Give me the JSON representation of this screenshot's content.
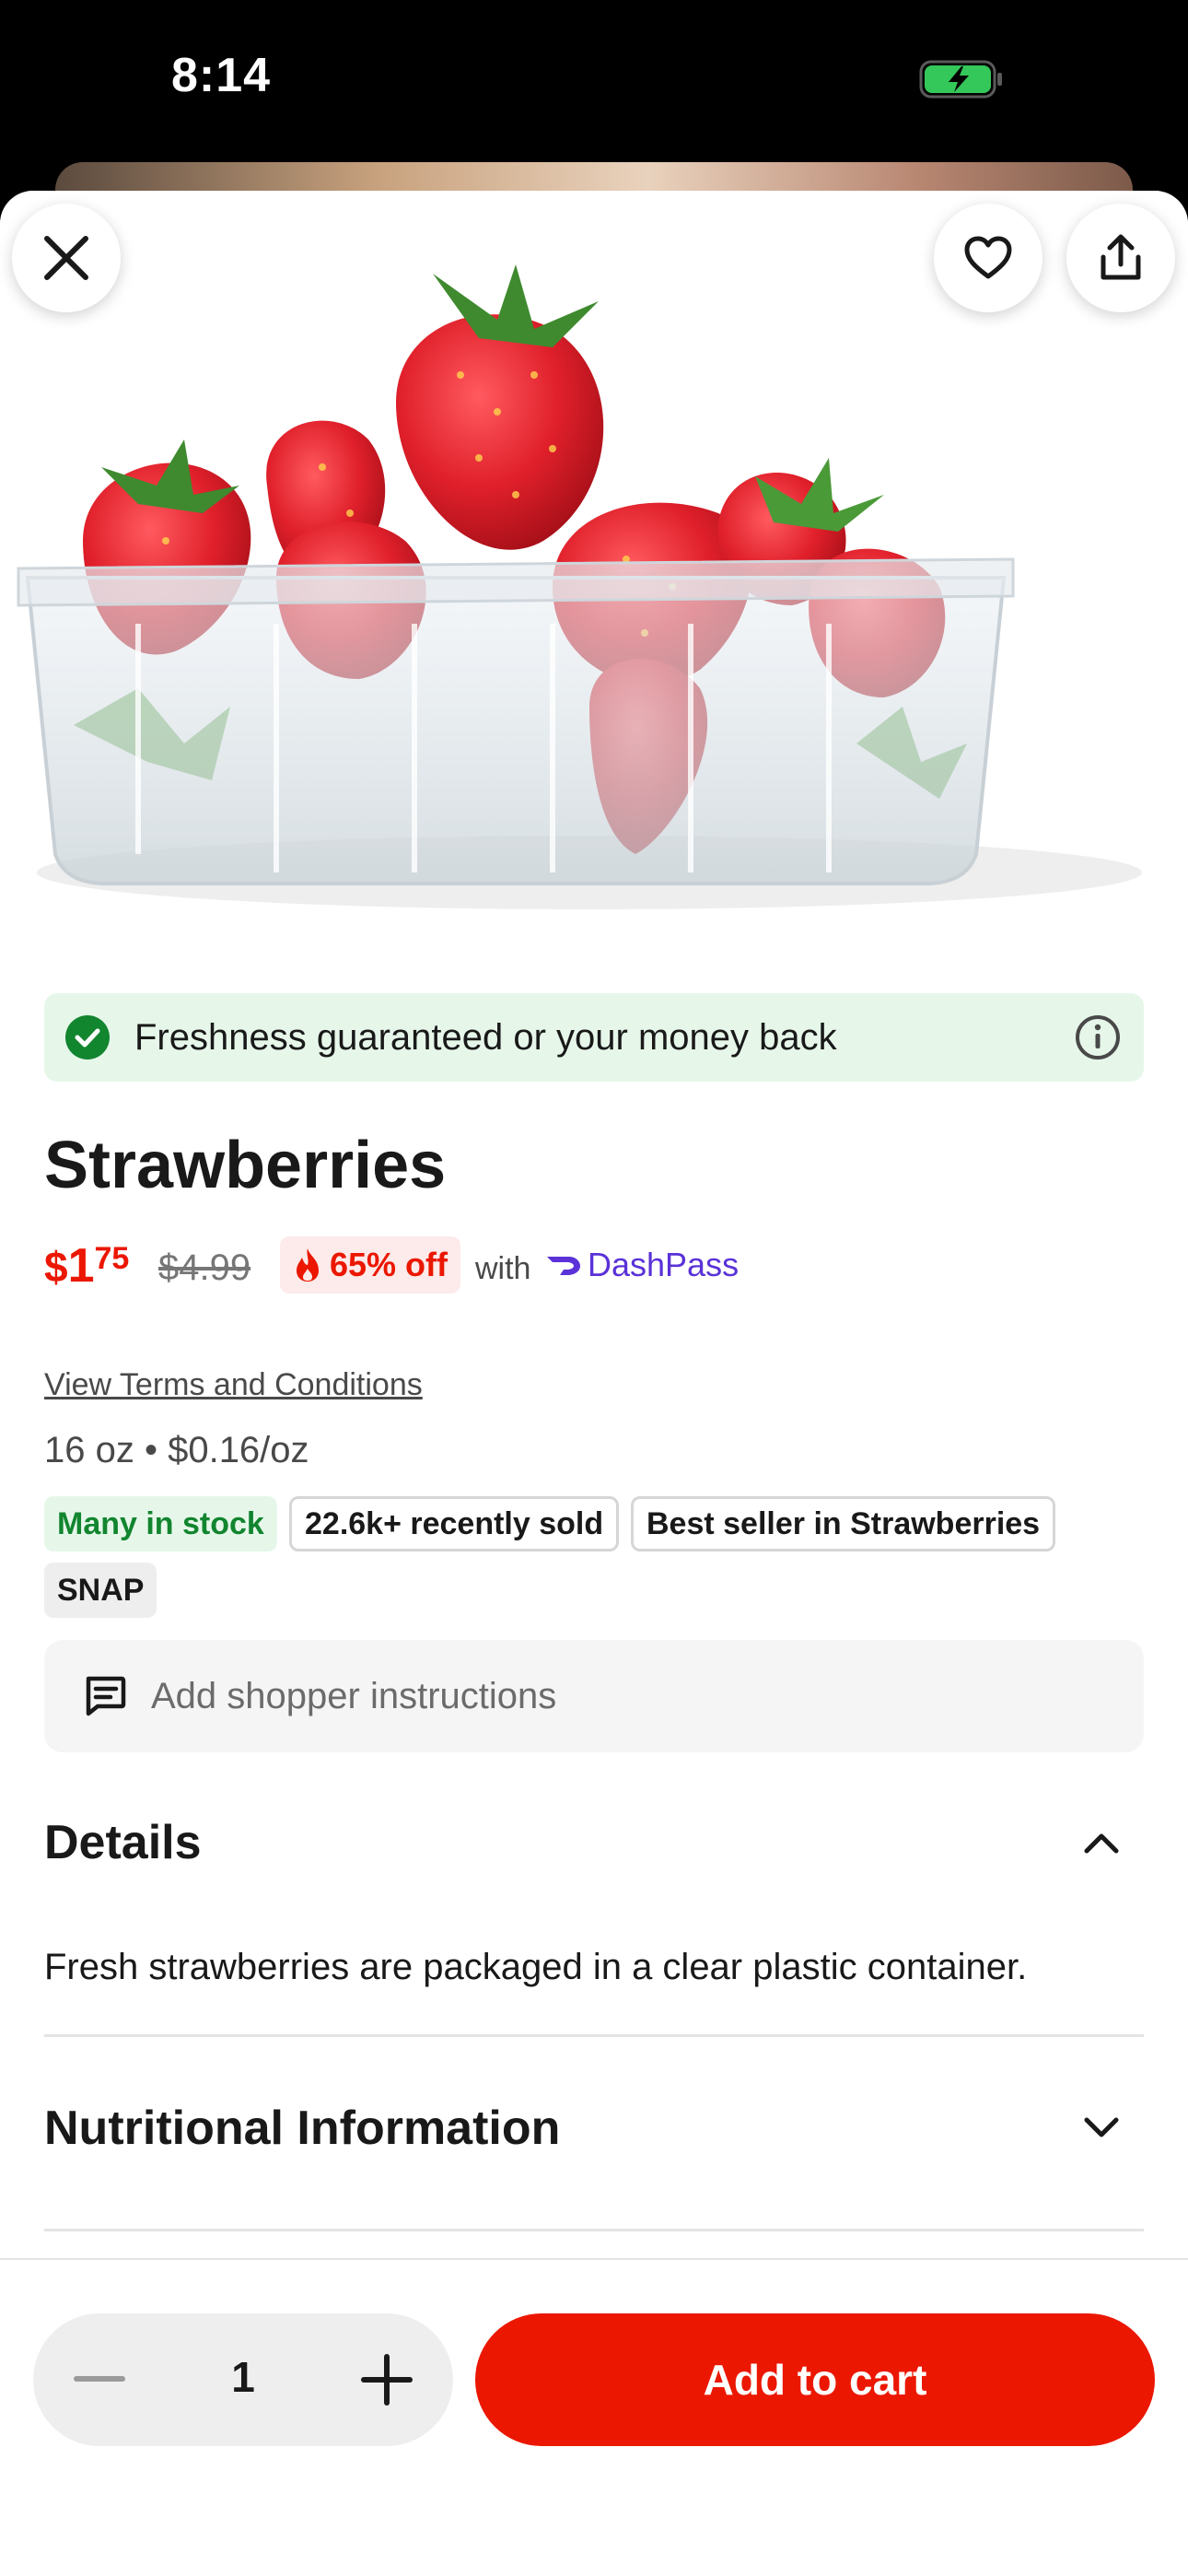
{
  "status_bar": {
    "time": "8:14",
    "battery_icon": "battery-charging-icon"
  },
  "header": {
    "close_icon": "close-icon",
    "favorite_icon": "heart-icon",
    "share_icon": "share-icon"
  },
  "banner": {
    "text": "Freshness guaranteed or your money back",
    "icon": "check-circle-icon",
    "info_icon": "info-icon"
  },
  "product": {
    "title": "Strawberries",
    "price_dollar": "$",
    "price_whole": "1",
    "price_cents": "75",
    "original_price": "$4.99",
    "discount": "65% off",
    "with_label": "with",
    "membership": "DashPass",
    "terms_link": "View Terms and Conditions",
    "size_info": "16 oz • $0.16/oz"
  },
  "tags": [
    "Many in stock",
    "22.6k+ recently sold",
    "Best seller in Strawberries",
    "SNAP"
  ],
  "instructions": {
    "placeholder": "Add shopper instructions"
  },
  "details": {
    "title": "Details",
    "body": "Fresh strawberries are packaged in a clear plastic container."
  },
  "nutrition": {
    "title": "Nutritional Information"
  },
  "cart": {
    "quantity": "1",
    "add_label": "Add to cart"
  },
  "colors": {
    "brand_red": "#eb1700",
    "dashpass_purple": "#5a32d8",
    "stock_green": "#12852f",
    "banner_green": "#e6f7ea"
  }
}
